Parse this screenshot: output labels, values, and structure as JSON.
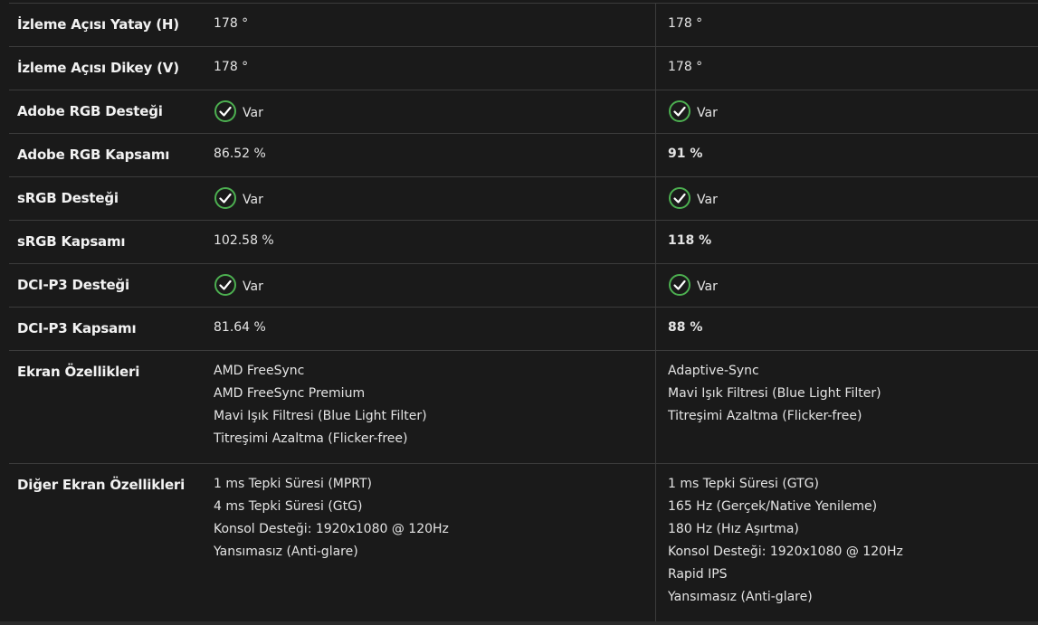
{
  "rows": [
    {
      "label": "İzleme Açısı Yatay (H)",
      "a": "178 °",
      "b": "178 °"
    },
    {
      "label": "İzleme Açısı Dikey (V)",
      "a": "178 °",
      "b": "178 °"
    },
    {
      "label": "Adobe RGB Desteği",
      "a": "Var",
      "b": "Var"
    },
    {
      "label": "Adobe RGB Kapsamı",
      "a": "86.52 %",
      "b": "91 %"
    },
    {
      "label": "sRGB Desteği",
      "a": "Var",
      "b": "Var"
    },
    {
      "label": "sRGB Kapsamı",
      "a": "102.58 %",
      "b": "118 %"
    },
    {
      "label": "DCI-P3 Desteği",
      "a": "Var",
      "b": "Var"
    },
    {
      "label": "DCI-P3 Kapsamı",
      "a": "81.64 %",
      "b": "88 %"
    }
  ],
  "ekran_ozellikleri": {
    "label": "Ekran Özellikleri",
    "a": [
      "AMD FreeSync",
      "AMD FreeSync Premium",
      "Mavi Işık Filtresi (Blue Light Filter)",
      "Titreşimi Azaltma (Flicker-free)"
    ],
    "b": [
      "Adaptive-Sync",
      "Mavi Işık Filtresi (Blue Light Filter)",
      "Titreşimi Azaltma (Flicker-free)"
    ]
  },
  "diger_ozellikler": {
    "label": "Diğer Ekran Özellikleri",
    "a": [
      "1 ms Tepki Süresi (MPRT)",
      "4 ms Tepki Süresi (GtG)",
      "Konsol Desteği: 1920x1080 @ 120Hz",
      "Yansımasız (Anti-glare)"
    ],
    "b": [
      "1 ms Tepki Süresi (GTG)",
      "165 Hz (Gerçek/Native Yenileme)",
      "180 Hz (Hız Aşırtma)",
      "Konsol Desteği: 1920x1080 @ 120Hz",
      "Rapid IPS",
      "Yansımasız (Anti-glare)"
    ]
  },
  "icons": {
    "supported": "check-circle-icon"
  },
  "colors": {
    "check": "#4caf50",
    "background": "#1a1a1a",
    "divider": "#3c3c3c"
  }
}
